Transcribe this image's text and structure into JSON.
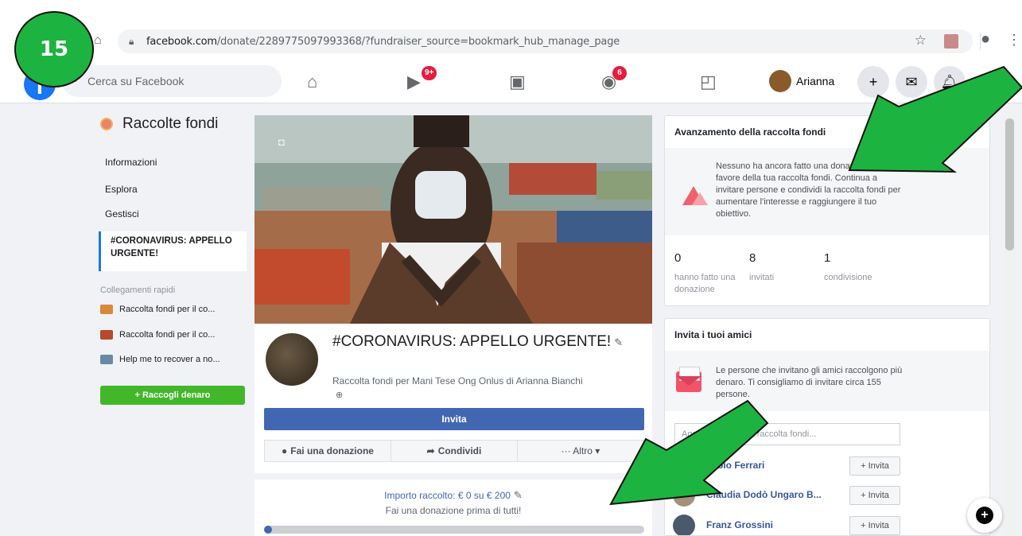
{
  "step": "15",
  "browser": {
    "url_host": "facebook.com",
    "url_path": "/donate/2289775097993368/?fundraiser_source=bookmark_hub_manage_page"
  },
  "header": {
    "search_placeholder": "Cerca su Facebook",
    "watch_badge": "9+",
    "groups_badge": "6",
    "user_name": "Arianna"
  },
  "sidebar": {
    "title": "Raccolte fondi",
    "links": [
      "Informazioni",
      "Esplora",
      "Gestisci"
    ],
    "active": "#CORONAVIRUS: APPELLO URGENTE!",
    "quick_links_title": "Collegamenti rapidi",
    "quick_links": [
      "Raccolta fondi per il co...",
      "Raccolta fondi per il co...",
      "Help me to recover a no..."
    ],
    "cta": "+  Raccogli denaro"
  },
  "fundraiser": {
    "title": "#CORONAVIRUS: APPELLO URGENTE!",
    "subtitle": "Raccolta fondi per Mani Tese Ong Onlus di Arianna Bianchi",
    "invite": "Invita",
    "actions": [
      "Fai una donazione",
      "Condividi",
      "··· Altro ▾"
    ],
    "amount": "Importo raccolto: € 0 su € 200",
    "first_donation": "Fai una donazione prima di tutti!",
    "progress": 0
  },
  "progress_card": {
    "title": "Avanzamento della raccolta fondi",
    "message": "Nessuno ha ancora fatto una donazione in favore della tua raccolta fondi. Continua a invitare persone e condividi la raccolta fondi per aumentare l'interesse e raggiungere il tuo obiettivo.",
    "stats": [
      {
        "value": "0",
        "label": "hanno fatto una donazione"
      },
      {
        "value": "8",
        "label": "invitati"
      },
      {
        "value": "1",
        "label": "condivisione"
      }
    ]
  },
  "invite_card": {
    "title": "Invita i tuoi amici",
    "message": "Le persone che invitano gli amici raccolgono più denaro. Ti consigliamo di invitare circa 155 persone.",
    "search_placeholder": "Aggiungi amici alla raccolta fondi...",
    "invite_label": "+ Invita",
    "friends": [
      "Fabio Ferrari",
      "Claudia Dodò Ungaro B...",
      "Franz Grossini"
    ]
  },
  "colors": {
    "annotation_arrow": "#1db340",
    "facebook_blue": "#4267b2"
  }
}
